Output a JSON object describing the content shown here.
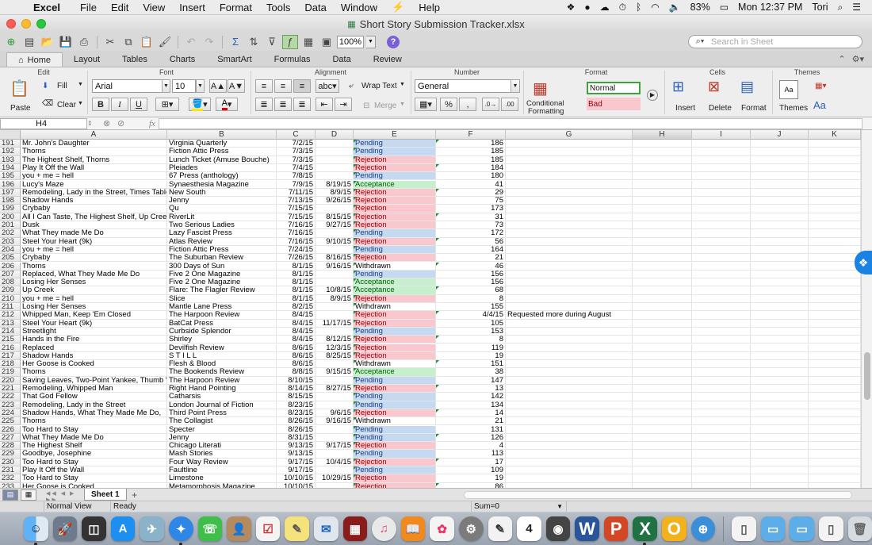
{
  "menubar": {
    "app": "Excel",
    "menus": [
      "File",
      "Edit",
      "View",
      "Insert",
      "Format",
      "Tools",
      "Data",
      "Window",
      "Help"
    ],
    "battery": "83%",
    "clock": "Mon 12:37 PM",
    "user": "Tori"
  },
  "window": {
    "title": "Short Story Submission Tracker.xlsx"
  },
  "toolbar": {
    "zoom": "100%",
    "search_placeholder": "Search in Sheet"
  },
  "ribbon_tabs": [
    "Home",
    "Layout",
    "Tables",
    "Charts",
    "SmartArt",
    "Formulas",
    "Data",
    "Review"
  ],
  "ribbon": {
    "groups": {
      "edit": "Edit",
      "font": "Font",
      "alignment": "Alignment",
      "number": "Number",
      "format": "Format",
      "cells": "Cells",
      "themes": "Themes"
    },
    "fill": "Fill",
    "clear": "Clear",
    "paste": "Paste",
    "font_name": "Arial",
    "font_size": "10",
    "wrap_text": "Wrap Text",
    "merge": "Merge",
    "number_format": "General",
    "conditional": "Conditional",
    "formatting": "Formatting",
    "style_normal": "Normal",
    "style_bad": "Bad",
    "insert": "Insert",
    "delete": "Delete",
    "format_btn": "Format",
    "themes_btn": "Themes",
    "bold": "B",
    "italic": "I",
    "underline": "U",
    "abc": "abc",
    "aa": "Aa"
  },
  "formula_bar": {
    "name_box": "H4",
    "fx": "fx"
  },
  "columns": [
    "A",
    "B",
    "C",
    "D",
    "E",
    "F",
    "G",
    "H",
    "I",
    "J",
    "K"
  ],
  "rows": [
    {
      "n": "191",
      "a": "Mr. John's Daughter",
      "b": "Virginia Quarterly",
      "c": "7/2/15",
      "d": "",
      "e": "Pending",
      "f": "186",
      "g": ""
    },
    {
      "n": "192",
      "a": "Thorns",
      "b": "Fiction Attic Press",
      "c": "7/3/15",
      "d": "",
      "e": "Pending",
      "f": "185",
      "g": ""
    },
    {
      "n": "193",
      "a": "The Highest Shelf, Thorns",
      "b": "Lunch Ticket (Amuse Bouche)",
      "c": "7/3/15",
      "d": "",
      "e": "Rejection",
      "f": "185",
      "g": ""
    },
    {
      "n": "194",
      "a": "Play It Off the Wall",
      "b": "Pleiades",
      "c": "7/4/15",
      "d": "",
      "e": "Rejection",
      "f": "184",
      "g": ""
    },
    {
      "n": "195",
      "a": "you + me = hell",
      "b": "67 Press (anthology)",
      "c": "7/8/15",
      "d": "",
      "e": "Pending",
      "f": "180",
      "g": ""
    },
    {
      "n": "196",
      "a": "Lucy's Maze",
      "b": "Synaesthesia Magazine",
      "c": "7/9/15",
      "d": "8/19/15",
      "e": "Acceptance",
      "f": "41",
      "g": ""
    },
    {
      "n": "197",
      "a": "Remodeling, Lady in the Street, Times Tables",
      "b": "New South",
      "c": "7/11/15",
      "d": "8/9/15",
      "e": "Rejection",
      "f": "29",
      "g": ""
    },
    {
      "n": "198",
      "a": "Shadow Hands",
      "b": "Jenny",
      "c": "7/13/15",
      "d": "9/26/15",
      "e": "Rejection",
      "f": "75",
      "g": ""
    },
    {
      "n": "199",
      "a": "Crybaby",
      "b": "Qu",
      "c": "7/15/15",
      "d": "",
      "e": "Rejection",
      "f": "173",
      "g": ""
    },
    {
      "n": "200",
      "a": "All I Can Taste, The Highest Shelf, Up Creek",
      "b": "RiverLit",
      "c": "7/15/15",
      "d": "8/15/15",
      "e": "Rejection",
      "f": "31",
      "g": ""
    },
    {
      "n": "201",
      "a": "Dusk",
      "b": "Two Serious Ladies",
      "c": "7/16/15",
      "d": "9/27/15",
      "e": "Rejection",
      "f": "73",
      "g": ""
    },
    {
      "n": "202",
      "a": "What They made Me Do",
      "b": "Lazy Fascist Press",
      "c": "7/16/15",
      "d": "",
      "e": "Pending",
      "f": "172",
      "g": ""
    },
    {
      "n": "203",
      "a": "Steel Your Heart (9k)",
      "b": "Atlas Review",
      "c": "7/16/15",
      "d": "9/10/15",
      "e": "Rejection",
      "f": "56",
      "g": ""
    },
    {
      "n": "204",
      "a": "you + me = hell",
      "b": "Fiction Attic Press",
      "c": "7/24/15",
      "d": "",
      "e": "Pending",
      "f": "164",
      "g": ""
    },
    {
      "n": "205",
      "a": "Crybaby",
      "b": "The Suburban Review",
      "c": "7/26/15",
      "d": "8/16/15",
      "e": "Rejection",
      "f": "21",
      "g": ""
    },
    {
      "n": "206",
      "a": "Thorns",
      "b": "300 Days of Sun",
      "c": "8/1/15",
      "d": "9/16/15",
      "e": "Withdrawn",
      "f": "46",
      "g": ""
    },
    {
      "n": "207",
      "a": "Replaced, What They Made Me Do",
      "b": "Five 2 One Magazine",
      "c": "8/1/15",
      "d": "",
      "e": "Pending",
      "f": "156",
      "g": ""
    },
    {
      "n": "208",
      "a": "Losing Her Senses",
      "b": "Five 2 One Magazine",
      "c": "8/1/15",
      "d": "",
      "e": "Acceptance",
      "f": "156",
      "g": ""
    },
    {
      "n": "209",
      "a": "Up Creek",
      "b": "Flare: The Flagler Review",
      "c": "8/1/15",
      "d": "10/8/15",
      "e": "Acceptance",
      "f": "68",
      "g": ""
    },
    {
      "n": "210",
      "a": "you + me = hell",
      "b": "Slice",
      "c": "8/1/15",
      "d": "8/9/15",
      "e": "Rejection",
      "f": "8",
      "g": ""
    },
    {
      "n": "211",
      "a": "Losing Her Senses",
      "b": "Mantle Lane Press",
      "c": "8/2/15",
      "d": "",
      "e": "Withdrawn",
      "f": "155",
      "g": ""
    },
    {
      "n": "212",
      "a": "Whipped Man, Keep 'Em Closed",
      "b": "The Harpoon Review",
      "c": "8/4/15",
      "d": "",
      "e": "Rejection",
      "f": "4/4/15",
      "g": "Requested more during August"
    },
    {
      "n": "213",
      "a": "Steel Your Heart (9k)",
      "b": "BatCat Press",
      "c": "8/4/15",
      "d": "11/17/15",
      "e": "Rejection",
      "f": "105",
      "g": ""
    },
    {
      "n": "214",
      "a": "Streetlight",
      "b": "Curbside Splendor",
      "c": "8/4/15",
      "d": "",
      "e": "Pending",
      "f": "153",
      "g": ""
    },
    {
      "n": "215",
      "a": "Hands in the Fire",
      "b": "Shirley",
      "c": "8/4/15",
      "d": "8/12/15",
      "e": "Rejection",
      "f": "8",
      "g": ""
    },
    {
      "n": "216",
      "a": "Replaced",
      "b": "Devilfish Review",
      "c": "8/6/15",
      "d": "12/3/15",
      "e": "Rejection",
      "f": "119",
      "g": ""
    },
    {
      "n": "217",
      "a": "Shadow Hands",
      "b": "S T I L L",
      "c": "8/6/15",
      "d": "8/25/15",
      "e": "Rejection",
      "f": "19",
      "g": ""
    },
    {
      "n": "218",
      "a": "Her Goose is Cooked",
      "b": "Flesh & Blood",
      "c": "8/6/15",
      "d": "",
      "e": "Withdrawn",
      "f": "151",
      "g": ""
    },
    {
      "n": "219",
      "a": "Thorns",
      "b": "The Bookends Review",
      "c": "8/8/15",
      "d": "9/15/15",
      "e": "Acceptance",
      "f": "38",
      "g": ""
    },
    {
      "n": "220",
      "a": "Saving Leaves, Two-Point Yankee, Thumb War",
      "b": "The Harpoon Review",
      "c": "8/10/15",
      "d": "",
      "e": "Pending",
      "f": "147",
      "g": ""
    },
    {
      "n": "221",
      "a": "Remodeling, Whipped Man",
      "b": "Right Hand Pointing",
      "c": "8/14/15",
      "d": "8/27/15",
      "e": "Rejection",
      "f": "13",
      "g": ""
    },
    {
      "n": "222",
      "a": "That God Fellow",
      "b": "Catharsis",
      "c": "8/15/15",
      "d": "",
      "e": "Pending",
      "f": "142",
      "g": ""
    },
    {
      "n": "223",
      "a": "Remodeling, Lady in the Street",
      "b": "London Journal of Fiction",
      "c": "8/23/15",
      "d": "",
      "e": "Pending",
      "f": "134",
      "g": ""
    },
    {
      "n": "224",
      "a": "Shadow Hands, What They Made Me Do,",
      "b": "Third Point Press",
      "c": "8/23/15",
      "d": "9/6/15",
      "e": "Rejection",
      "f": "14",
      "g": ""
    },
    {
      "n": "225",
      "a": "Thorns",
      "b": "The Collagist",
      "c": "8/26/15",
      "d": "9/16/15",
      "e": "Withdrawn",
      "f": "21",
      "g": ""
    },
    {
      "n": "226",
      "a": "Too Hard to Stay",
      "b": "Specter",
      "c": "8/26/15",
      "d": "",
      "e": "Pending",
      "f": "131",
      "g": ""
    },
    {
      "n": "227",
      "a": "What They Made Me Do",
      "b": "Jenny",
      "c": "8/31/15",
      "d": "",
      "e": "Pending",
      "f": "126",
      "g": ""
    },
    {
      "n": "228",
      "a": "The Highest Shelf",
      "b": "Chicago Literati",
      "c": "9/13/15",
      "d": "9/17/15",
      "e": "Rejection",
      "f": "4",
      "g": ""
    },
    {
      "n": "229",
      "a": "Goodbye, Josephine",
      "b": "Mash Stories",
      "c": "9/13/15",
      "d": "",
      "e": "Pending",
      "f": "113",
      "g": ""
    },
    {
      "n": "230",
      "a": "Too Hard to Stay",
      "b": "Four Way Review",
      "c": "9/17/15",
      "d": "10/4/15",
      "e": "Rejection",
      "f": "17",
      "g": ""
    },
    {
      "n": "231",
      "a": "Play It Off the Wall",
      "b": "Faultline",
      "c": "9/17/15",
      "d": "",
      "e": "Pending",
      "f": "109",
      "g": ""
    },
    {
      "n": "232",
      "a": "Too Hard to Stay",
      "b": "Limestone",
      "c": "10/10/15",
      "d": "10/29/15",
      "e": "Rejection",
      "f": "19",
      "g": ""
    },
    {
      "n": "233",
      "a": "Her Goose is Cooked",
      "b": "Metamorphosis Magazine",
      "c": "10/10/15",
      "d": "",
      "e": "Rejection",
      "f": "86",
      "g": ""
    }
  ],
  "sheet_tab": "Sheet 1",
  "status": {
    "view": "Normal View",
    "state": "Ready",
    "sum": "Sum=0"
  },
  "colors": {
    "pending": "#c5d9f1",
    "rejection": "#f9c7ce",
    "acceptance": "#c6efce"
  }
}
